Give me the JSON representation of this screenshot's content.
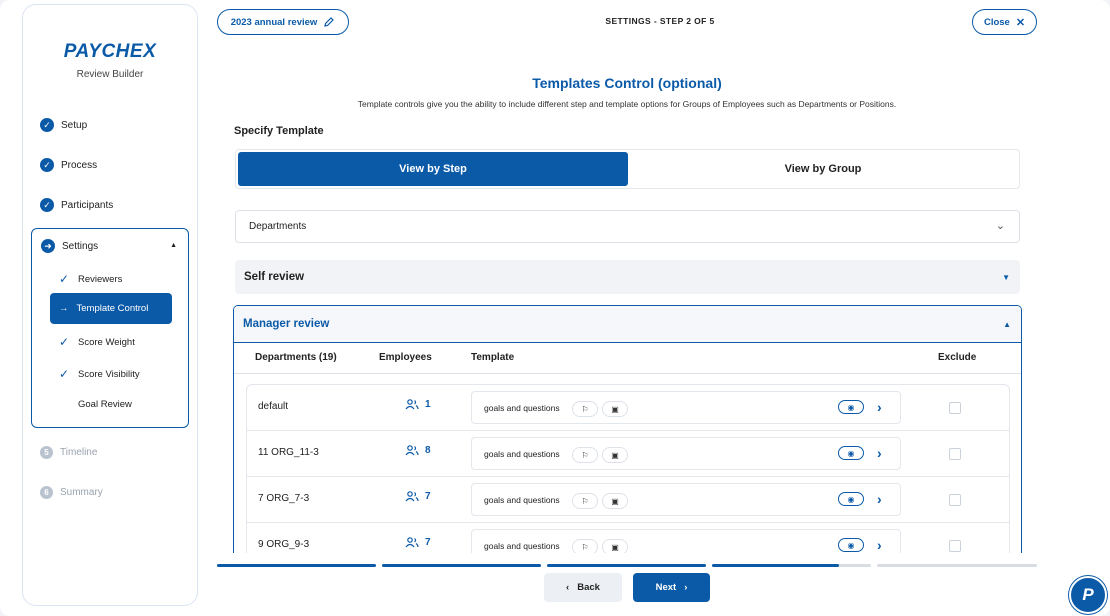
{
  "sidebar": {
    "brand": "PAYCHEX",
    "subtitle": "Review Builder",
    "steps": [
      {
        "label": "Setup",
        "state": "done"
      },
      {
        "label": "Process",
        "state": "done"
      },
      {
        "label": "Participants",
        "state": "done"
      },
      {
        "label": "Settings",
        "state": "current"
      },
      {
        "label": "Timeline",
        "state": "pending",
        "number": "5"
      },
      {
        "label": "Summary",
        "state": "pending",
        "number": "6"
      }
    ],
    "settings_sub": [
      {
        "label": "Reviewers",
        "state": "done"
      },
      {
        "label": "Template Control",
        "state": "active"
      },
      {
        "label": "Score Weight",
        "state": "done"
      },
      {
        "label": "Score Visibility",
        "state": "done"
      },
      {
        "label": "Goal Review",
        "state": "disabled"
      }
    ]
  },
  "header": {
    "review_name": "2023 annual review",
    "step_title": "SETTINGS - STEP 2 OF 5",
    "close_label": "Close"
  },
  "main": {
    "title": "Templates Control (optional)",
    "description": "Template controls give you the ability to include different step and template options for Groups of Employees such as Departments or Positions.",
    "specify_label": "Specify Template",
    "toggle": {
      "by_step": "View by Step",
      "by_group": "View by Group"
    },
    "dropdown_value": "Departments",
    "self_review": "Self review",
    "manager_review": "Manager review",
    "columns": {
      "departments": "Departments (19)",
      "employees": "Employees",
      "template": "Template",
      "exclude": "Exclude"
    },
    "rows": [
      {
        "dept": "default",
        "employees": "1",
        "template": "goals and questions"
      },
      {
        "dept": "11 ORG_11-3",
        "employees": "8",
        "template": "goals and questions"
      },
      {
        "dept": "7 ORG_7-3",
        "employees": "7",
        "template": "goals and questions"
      },
      {
        "dept": "9 ORG_9-3",
        "employees": "7",
        "template": "goals and questions"
      }
    ]
  },
  "footer": {
    "back_label": "Back",
    "next_label": "Next",
    "progress": [
      1,
      1,
      1,
      0.8,
      0
    ]
  },
  "colors": {
    "accent": "#0b5aa8",
    "track": "#d8dde3"
  }
}
